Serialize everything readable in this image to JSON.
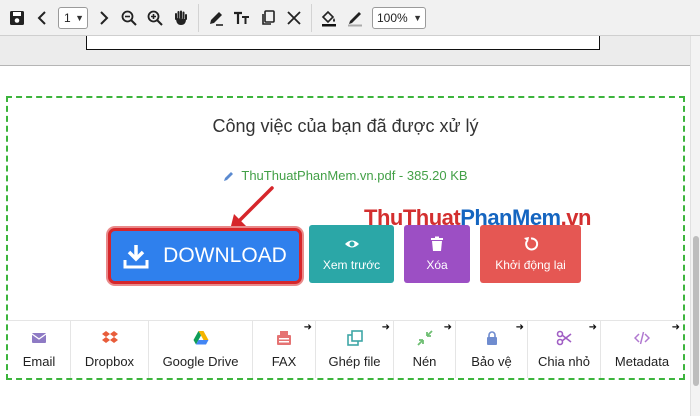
{
  "toolbar": {
    "page_number": "1",
    "zoom": "100%"
  },
  "panel": {
    "status_title": "Công việc của bạn đã được xử lý",
    "file_name": "ThuThuatPhanMem.vn.pdf",
    "file_size": "385.20 KB",
    "file_separator": " - "
  },
  "watermark": {
    "part_red": "ThuThuat",
    "part_blue": "PhanMem",
    "part_red2": ".vn"
  },
  "actions": {
    "download": "DOWNLOAD",
    "view": "Xem trước",
    "delete": "Xóa",
    "restart": "Khởi động lại"
  },
  "tools": [
    {
      "label": "Email",
      "icon": "envelope-icon"
    },
    {
      "label": "Dropbox",
      "icon": "dropbox-icon"
    },
    {
      "label": "Google Drive",
      "icon": "google-drive-icon"
    },
    {
      "label": "FAX",
      "icon": "fax-icon"
    },
    {
      "label": "Ghép file",
      "icon": "merge-icon"
    },
    {
      "label": "Nén",
      "icon": "compress-icon"
    },
    {
      "label": "Bảo vệ",
      "icon": "lock-icon"
    },
    {
      "label": "Chia nhỏ",
      "icon": "scissors-icon"
    },
    {
      "label": "Metadata",
      "icon": "code-icon"
    }
  ],
  "colors": {
    "download": "#2f80ed",
    "view": "#2ba7a7",
    "delete": "#9c4fc4",
    "restart": "#e55753",
    "dashed_border": "#3cb43c",
    "file_text": "#43a047"
  }
}
